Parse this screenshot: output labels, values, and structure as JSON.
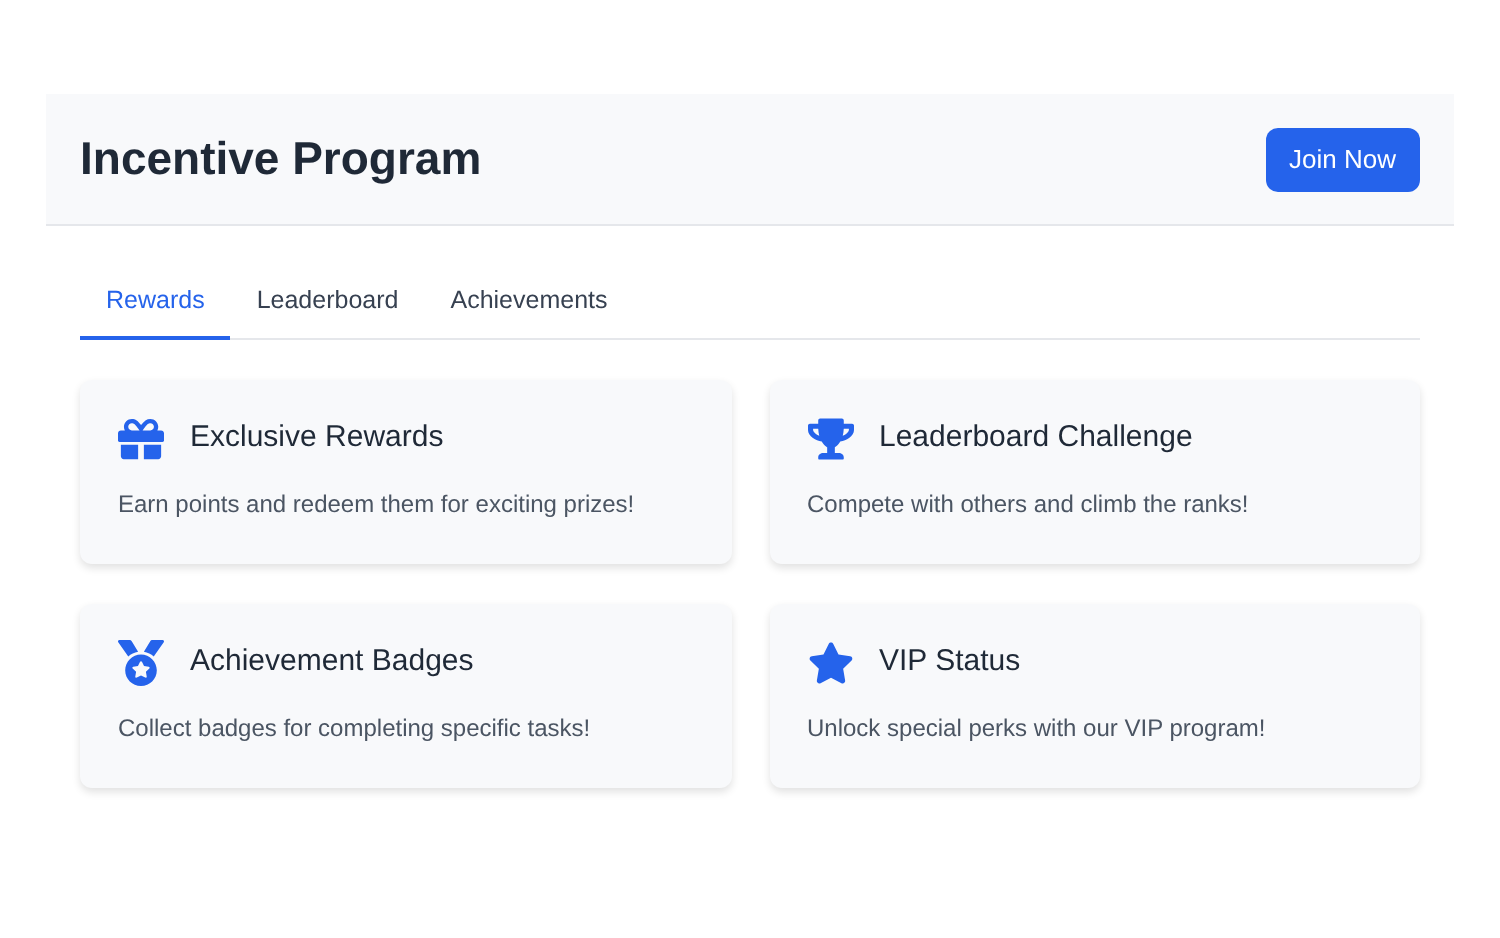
{
  "header": {
    "title": "Incentive Program",
    "button": "Join Now"
  },
  "tabs": [
    {
      "label": "Rewards",
      "selected": true
    },
    {
      "label": "Leaderboard",
      "selected": false
    },
    {
      "label": "Achievements",
      "selected": false
    }
  ],
  "cards": [
    {
      "title": "Exclusive Rewards",
      "text": "Earn points and redeem them for exciting prizes!"
    },
    {
      "title": "Leaderboard Challenge",
      "text": "Compete with others and climb the ranks!"
    },
    {
      "title": "Achievement Badges",
      "text": "Collect badges for completing specific tasks!"
    },
    {
      "title": "VIP Status",
      "text": "Unlock special perks with our VIP program!"
    }
  ]
}
